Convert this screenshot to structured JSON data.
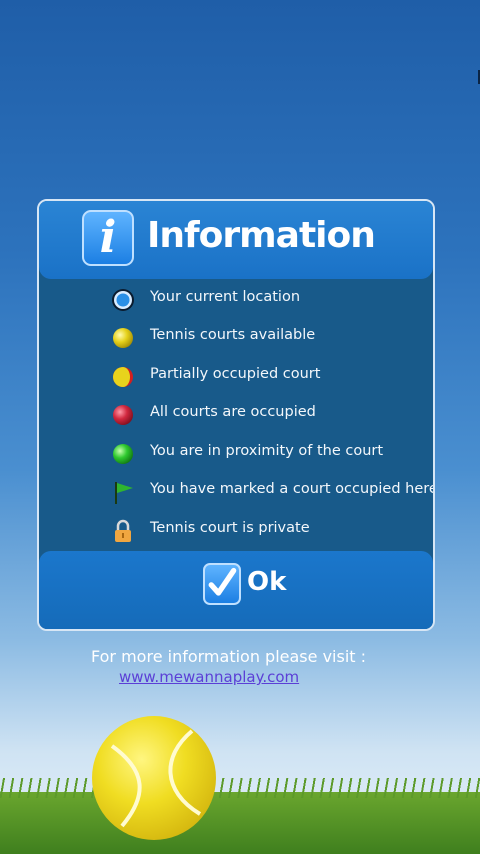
{
  "dialog": {
    "title": "Information",
    "icon": "info-icon",
    "legend": [
      {
        "icon": "current-location-icon",
        "label": "Your current location"
      },
      {
        "icon": "yellow-ball-icon",
        "label": "Tennis courts available"
      },
      {
        "icon": "yellow-red-ball-icon",
        "label": "Partially occupied court"
      },
      {
        "icon": "red-ball-icon",
        "label": "All courts are occupied"
      },
      {
        "icon": "green-ball-icon",
        "label": "You are in proximity of the court"
      },
      {
        "icon": "green-flag-icon",
        "label": "You have marked a court occupied here"
      },
      {
        "icon": "padlock-icon",
        "label": "Tennis court is private"
      }
    ],
    "ok_label": "Ok"
  },
  "footer": {
    "visit_text": "For more information please visit :",
    "link_text": "www.mewannaplay.com"
  },
  "colors": {
    "dialog_bg": "#185a8a",
    "header_bg": "#1a72c7",
    "link": "#5b3fd6"
  }
}
